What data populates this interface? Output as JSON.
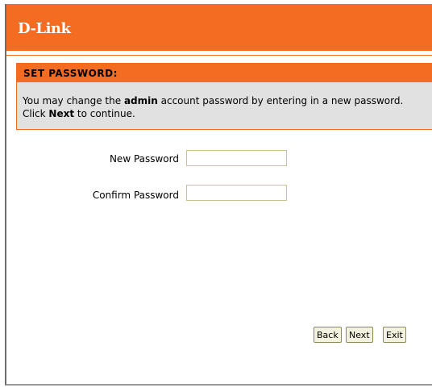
{
  "brand": {
    "logo_text": "D-Link"
  },
  "section": {
    "title": "SET PASSWORD:",
    "desc_part1": "You may change the ",
    "desc_bold1": "admin",
    "desc_part2": " account password by entering in a new password. Click ",
    "desc_bold2": "Next",
    "desc_part3": " to continue."
  },
  "form": {
    "new_password_label": "New Password",
    "new_password_value": "",
    "confirm_password_label": "Confirm Password",
    "confirm_password_value": ""
  },
  "buttons": {
    "back": "Back",
    "next": "Next",
    "exit": "Exit"
  },
  "colors": {
    "accent": "#f36c22",
    "section_bg": "#e1e1e1"
  }
}
